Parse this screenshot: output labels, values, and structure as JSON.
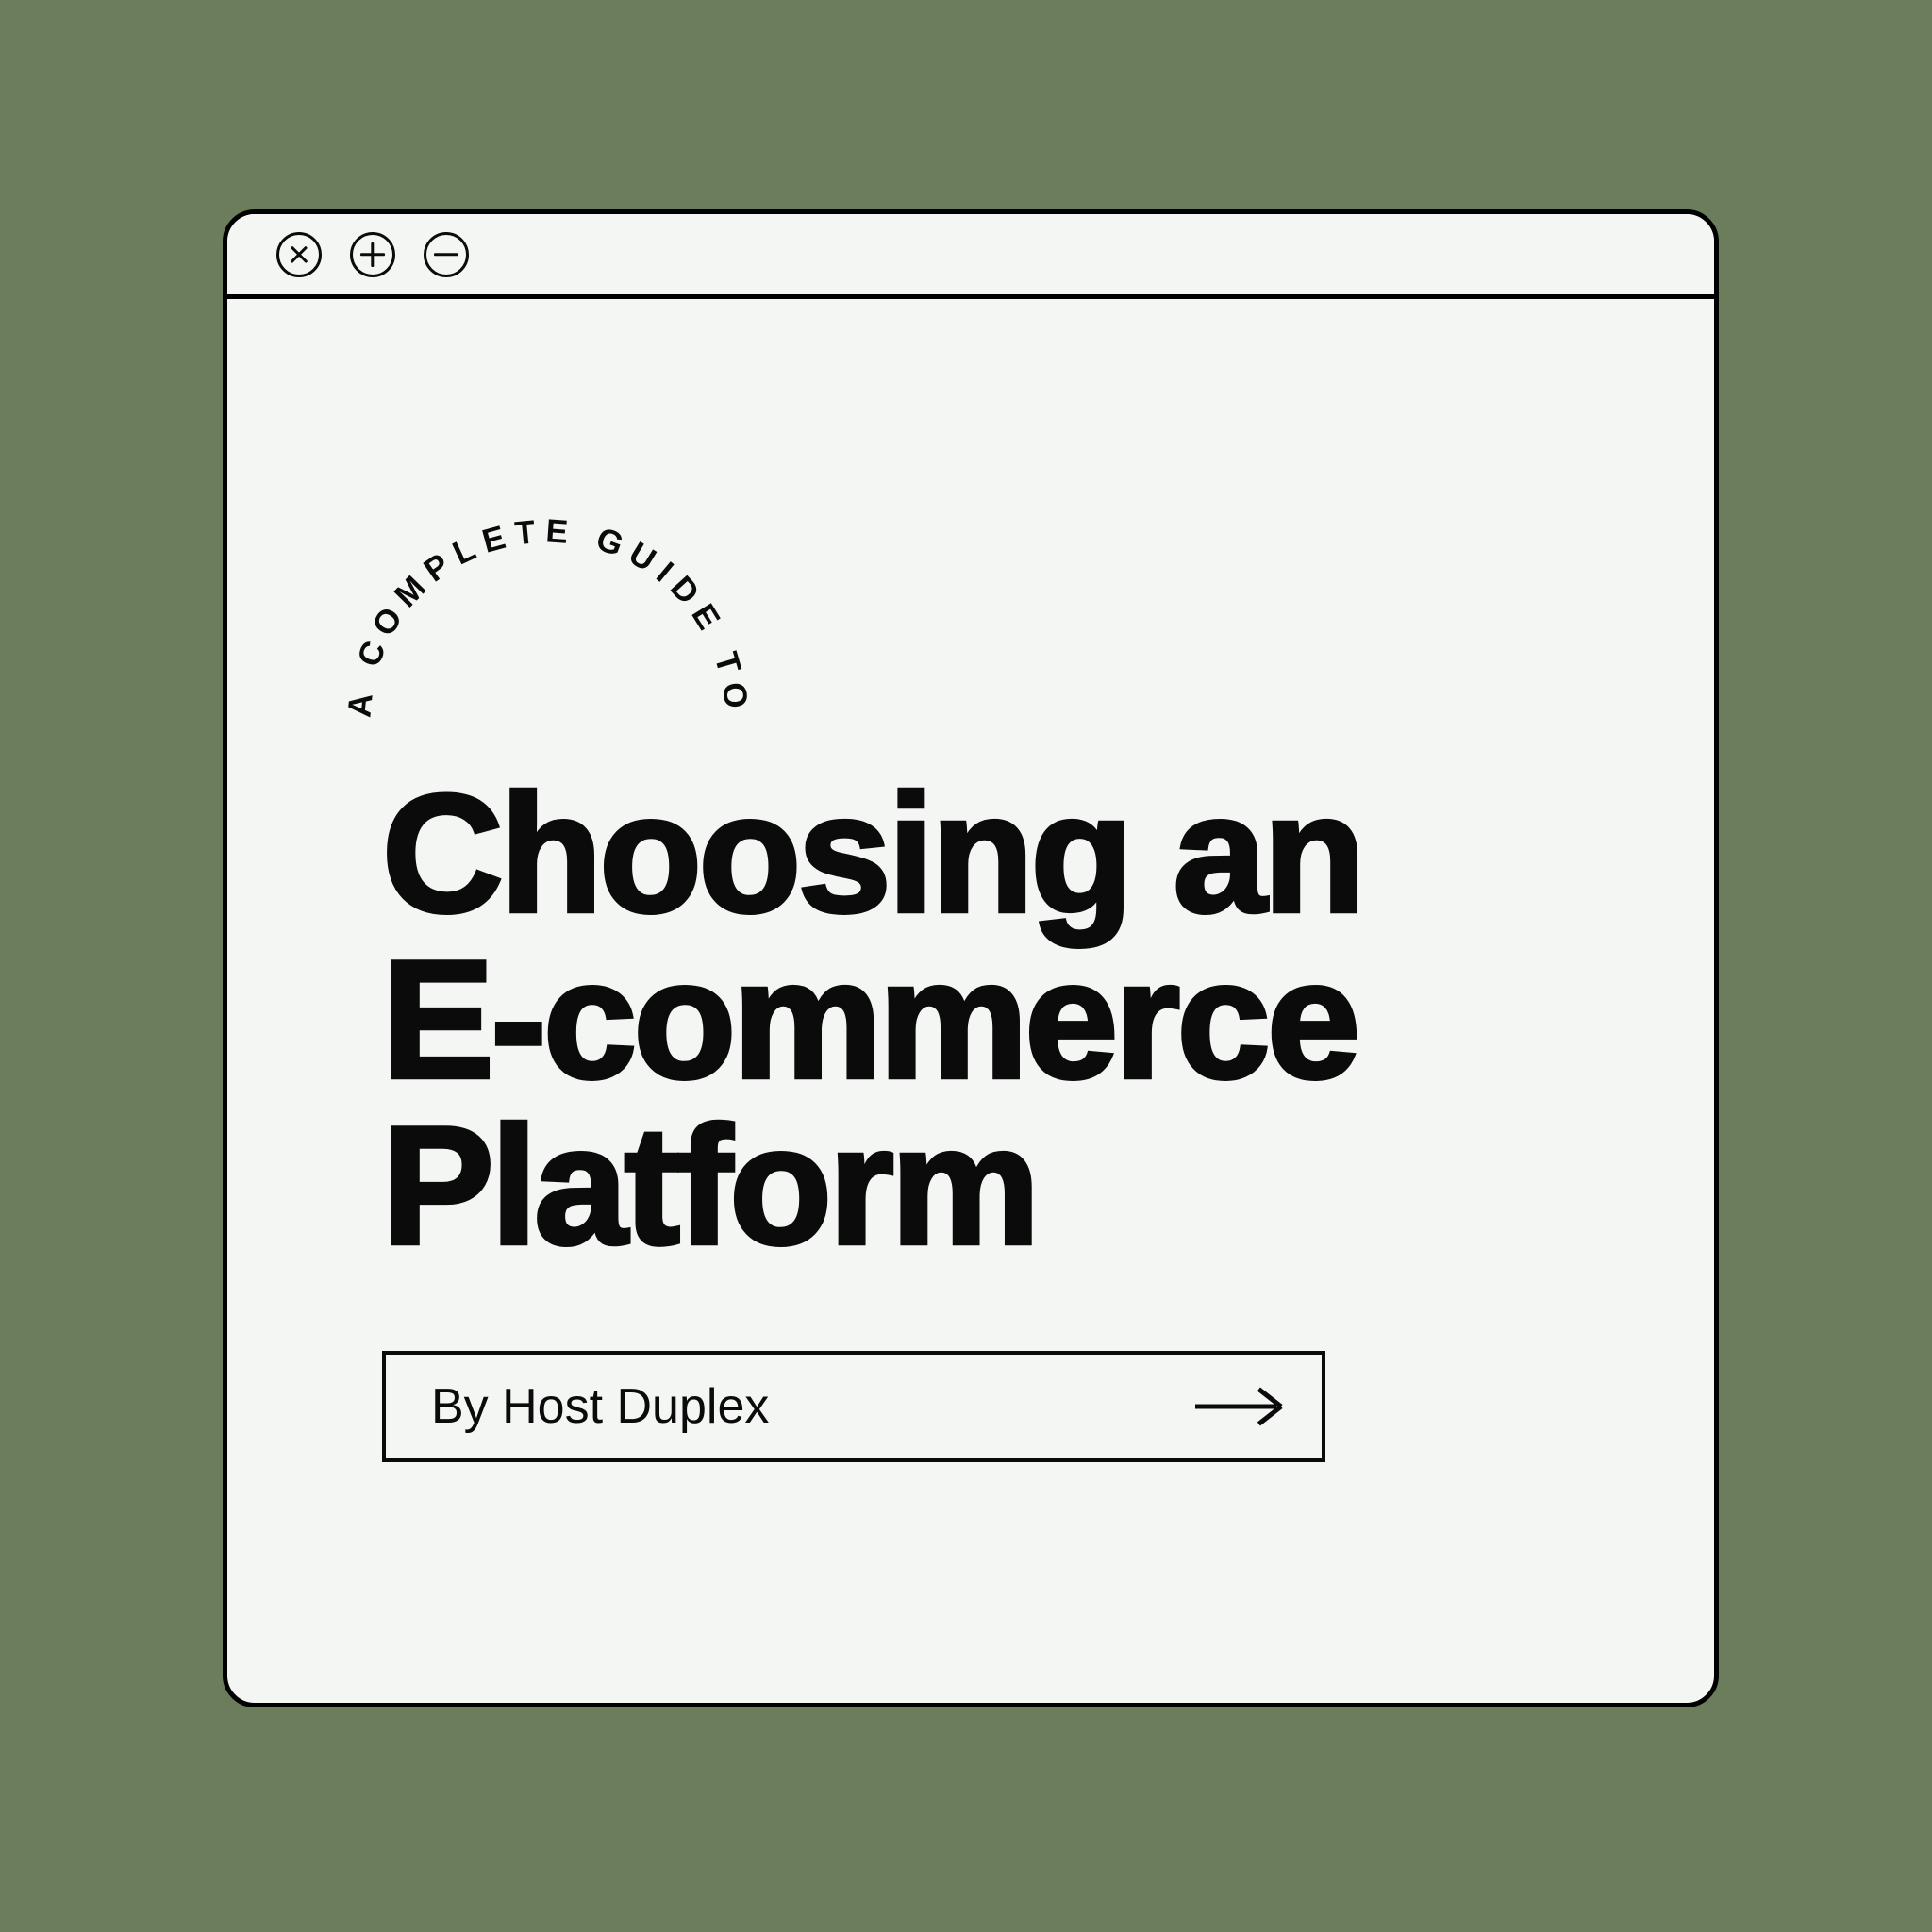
{
  "page": {
    "background_color": "#6B7D5A",
    "card_background_color": "#F4F6F4",
    "ink_color": "#0B0B0B"
  },
  "window": {
    "controls": [
      {
        "name": "close-icon",
        "glyph": "x",
        "label": "Close"
      },
      {
        "name": "plus-icon",
        "glyph": "+",
        "label": "Add"
      },
      {
        "name": "minus-icon",
        "glyph": "-",
        "label": "Minimize"
      }
    ]
  },
  "hero": {
    "eyebrow_arc": "A COMPLETE GUIDE TO",
    "headline_lines": [
      "Choosing an",
      "E-commerce",
      "Platform"
    ],
    "headline_full": "Choosing an E-commerce Platform"
  },
  "cta": {
    "label": "By Host Duplex",
    "arrow_icon": "arrow-right-icon"
  }
}
